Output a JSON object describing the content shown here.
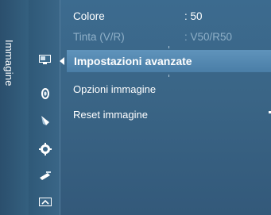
{
  "category": {
    "label": "Immagine"
  },
  "rows_top": [
    {
      "name": "Colore",
      "value": ": 50"
    },
    {
      "name": "Tinta (V/R)",
      "value": ": V50/R50"
    }
  ],
  "selected": {
    "name": "Impostazioni avanzate"
  },
  "rows": [
    {
      "name": "Opzioni immagine"
    },
    {
      "name": "Reset immagine"
    }
  ],
  "icons": [
    "display-icon",
    "sound-icon",
    "channel-icon",
    "settings-gear-icon",
    "satellite-icon",
    "input-icon"
  ],
  "colors": {
    "background": "#3a6687",
    "selected": "#5588b0",
    "dim_text": "#8fb0c8"
  }
}
